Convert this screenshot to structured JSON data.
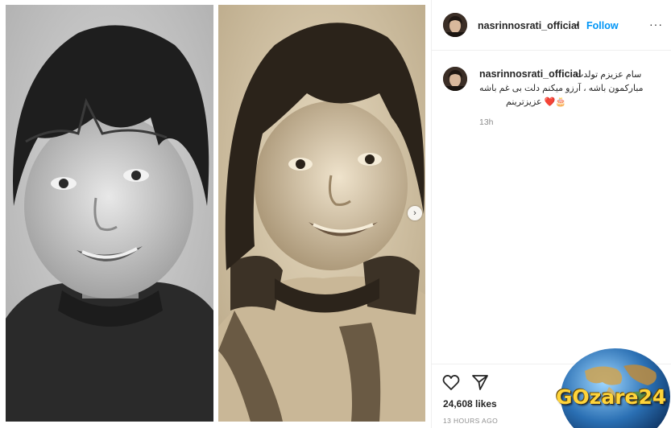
{
  "post": {
    "username": "nasrinnosrati_official",
    "separator": "•",
    "follow_label": "Follow",
    "more_label": "···"
  },
  "caption": {
    "username": "nasrinnosrati_official",
    "lines": [
      "سام عزیزم تولدت",
      "مبارکمون باشه ، آرزو میکنم دلت بی غم باشه",
      "🎂❤️ عزیزترینم"
    ],
    "time": "13h"
  },
  "actions": {
    "like_icon": "heart-icon",
    "share_icon": "send-icon",
    "likes": "24,608 likes",
    "posted_ago": "13 HOURS AGO"
  },
  "media": {
    "next_icon": "chevron-right-icon",
    "next_glyph": "›"
  },
  "watermark": {
    "text": "GOzare24"
  },
  "colors": {
    "accent": "#0095f6",
    "text": "#262626",
    "muted": "#8e8e8e",
    "divider": "#efefef"
  }
}
